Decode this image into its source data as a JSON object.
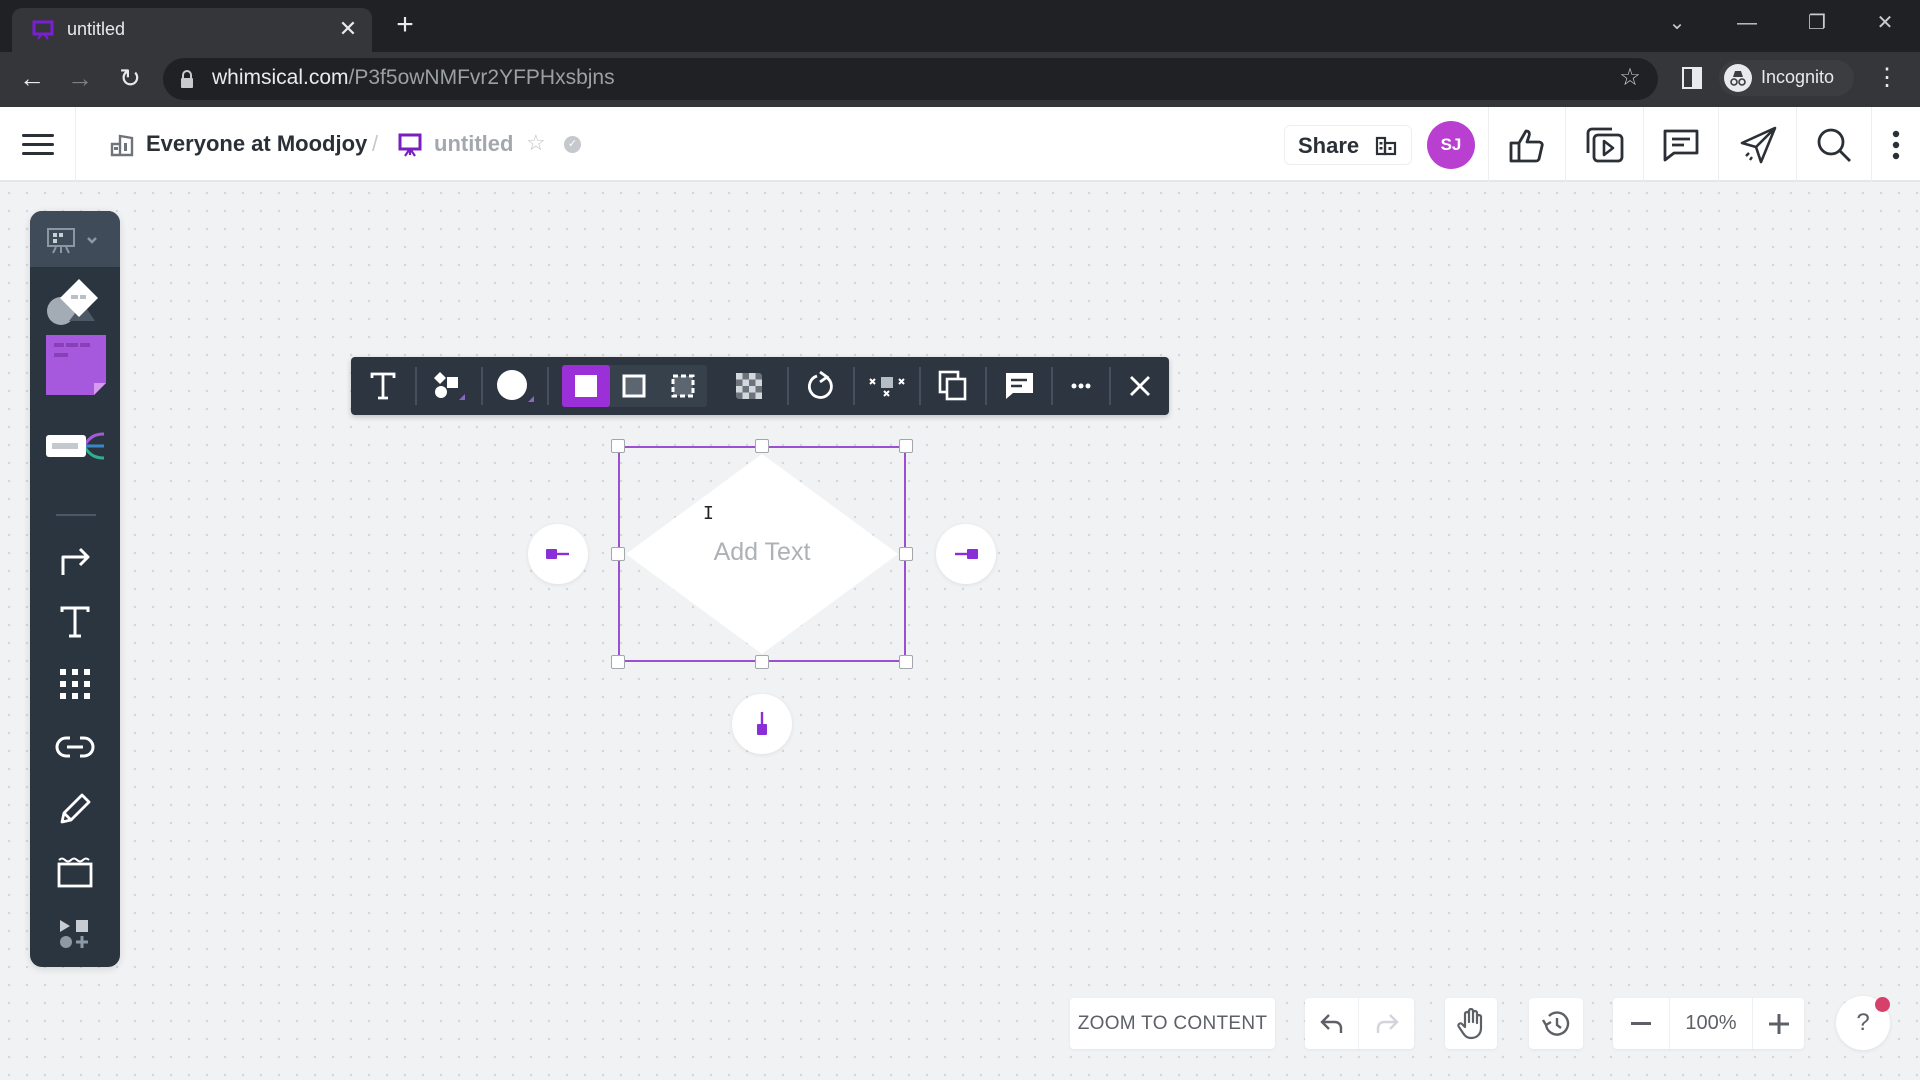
{
  "browser": {
    "tab_title": "untitled",
    "url_domain": "whimsical.com",
    "url_path": "/P3f5owNMFvr2YFPHxsbjns",
    "profile_label": "Incognito"
  },
  "header": {
    "workspace": "Everyone at Moodjoy",
    "separator": "/",
    "doc_title": "untitled",
    "share_label": "Share",
    "avatar_initials": "SJ"
  },
  "colors": {
    "accent": "#9b30d9",
    "avatar": "#b93fd0",
    "notification": "#d6416b",
    "toolbar_bg": "#2c3540"
  },
  "sidebar": {
    "items": [
      "presentation-mode",
      "shapes",
      "sticky-note",
      "mind-map",
      "connector",
      "text",
      "grid",
      "link",
      "pencil",
      "frame",
      "more-tools"
    ]
  },
  "shape_toolbar": {
    "items": [
      "text",
      "shape-type",
      "fill-color",
      "border-solid",
      "border-thin",
      "border-dashed",
      "opacity",
      "rotate",
      "align",
      "duplicate",
      "comment",
      "more",
      "close"
    ]
  },
  "canvas": {
    "shape": "diamond",
    "placeholder": "Add Text"
  },
  "bottom_bar": {
    "zoom_to_content": "ZOOM TO CONTENT",
    "zoom_level": "100%",
    "help": "?"
  }
}
